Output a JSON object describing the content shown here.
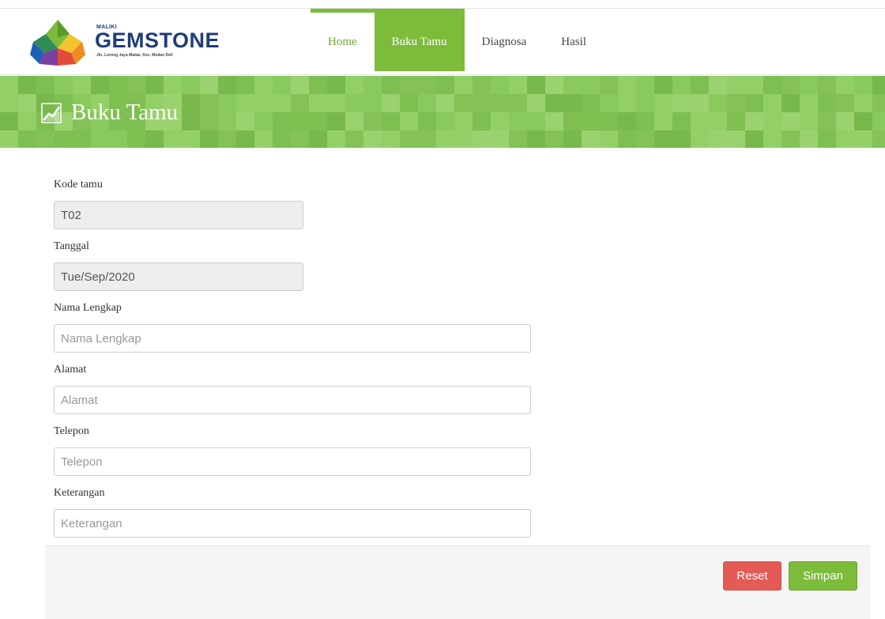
{
  "brand": {
    "small_text": "MALIKI",
    "name": "GEMSTONE",
    "address": "Jln. Lorong Jaya Mabar, Kec. Medan Deli"
  },
  "nav": {
    "items": [
      {
        "label": "Home"
      },
      {
        "label": "Buku Tamu"
      },
      {
        "label": "Diagnosa"
      },
      {
        "label": "Hasil"
      }
    ],
    "active": "Buku Tamu"
  },
  "page": {
    "title": "Buku Tamu",
    "icon": "line-chart-icon"
  },
  "form": {
    "kode_tamu": {
      "label": "Kode tamu",
      "value": "T02"
    },
    "tanggal": {
      "label": "Tanggal",
      "value": "Tue/Sep/2020"
    },
    "nama": {
      "label": "Nama Lengkap",
      "placeholder": "Nama Lengkap"
    },
    "alamat": {
      "label": "Alamat",
      "placeholder": "Alamat"
    },
    "telepon": {
      "label": "Telepon",
      "placeholder": "Telepon"
    },
    "keterangan": {
      "label": "Keterangan",
      "placeholder": "Keterangan"
    }
  },
  "actions": {
    "reset_label": "Reset",
    "save_label": "Simpan"
  },
  "colors": {
    "accent": "#7dbb3b",
    "danger": "#e45a55",
    "brand_blue": "#1f3d7a"
  }
}
